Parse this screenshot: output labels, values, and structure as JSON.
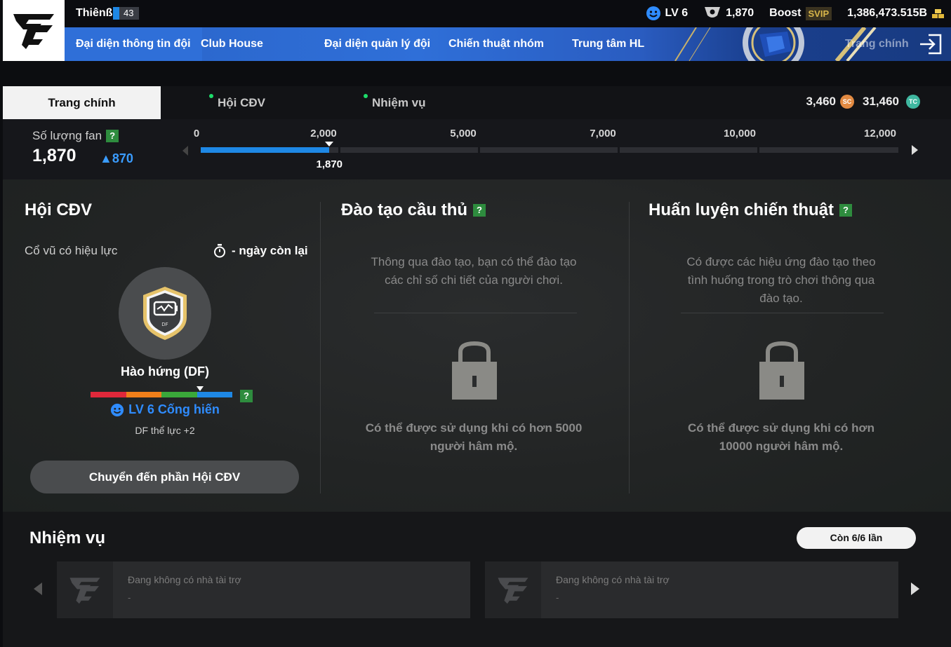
{
  "header": {
    "player_name": "Thiênß",
    "player_level": "43",
    "level_label": "LV 6",
    "fans": "1,870",
    "boost_label": "Boost",
    "svip_label": "SVIP",
    "money": "1,386,473.515B"
  },
  "nav": {
    "items": [
      "Đại diện thông tin đội",
      "Club House",
      "Đại diện quản lý đội",
      "Chiến thuật nhóm",
      "Trung tâm HL",
      "Trang chính"
    ]
  },
  "subtabs": {
    "main": "Trang chính",
    "fanclub": "Hội CĐV",
    "missions": "Nhiệm vụ",
    "sc_amount": "3,460",
    "sc_label": "SC",
    "tc_amount": "31,460",
    "tc_label": "TC"
  },
  "fan_progress": {
    "label": "Số lượng fan",
    "count": "1,870",
    "delta": "▲870",
    "ticks": [
      "0",
      "2,000",
      "5,000",
      "7,000",
      "10,000",
      "12,000"
    ],
    "current": "1,870",
    "current_value": 1870
  },
  "fanclub": {
    "title": "Hội CĐV",
    "effect_label": "Cổ vũ có hiệu lực",
    "days_left": "- ngày còn lại",
    "badge_tag": "DF",
    "badge_name": "Hào hứng (DF)",
    "level": "LV 6 Cống hiến",
    "bonus": "DF thể lực +2",
    "goto_button": "Chuyển đến phần Hội CĐV"
  },
  "training": {
    "title": "Đào tạo cầu thủ",
    "desc_line1": "Thông qua đào tạo, bạn có thể đào tạo",
    "desc_line2": "các chỉ số chi tiết của người chơi.",
    "lock_line1": "Có thể được sử dụng khi có hơn 5000",
    "lock_line2": "người hâm mộ."
  },
  "tactics": {
    "title": "Huấn luyện chiến thuật",
    "desc_line1": "Có được các hiệu ứng đào tạo theo",
    "desc_line2": "tình huống trong trò chơi thông qua",
    "desc_line3": "đào tạo.",
    "lock_line1": "Có thể được sử dụng khi có hơn",
    "lock_line2": "10000 người hâm mộ."
  },
  "missions": {
    "title": "Nhiệm vụ",
    "remaining": "Còn 6/6 lần",
    "cards": [
      {
        "title": "Đang không có nhà tài trợ",
        "sub": "-"
      },
      {
        "title": "Đang không có nhà tài trợ",
        "sub": "-"
      }
    ]
  },
  "colors": {
    "accent_blue": "#1e88e5",
    "question_green": "#2e8c3e",
    "online_dot": "#1ddc6a"
  },
  "icons": [
    "fc-logo",
    "smiley-icon",
    "trophy-icon",
    "gold-bars-icon",
    "exit-icon",
    "sc-coin-icon",
    "tc-coin-icon",
    "help-icon",
    "stopwatch-icon",
    "battery-badge-icon",
    "lock-icon",
    "chevron-left-icon",
    "chevron-right-icon"
  ]
}
